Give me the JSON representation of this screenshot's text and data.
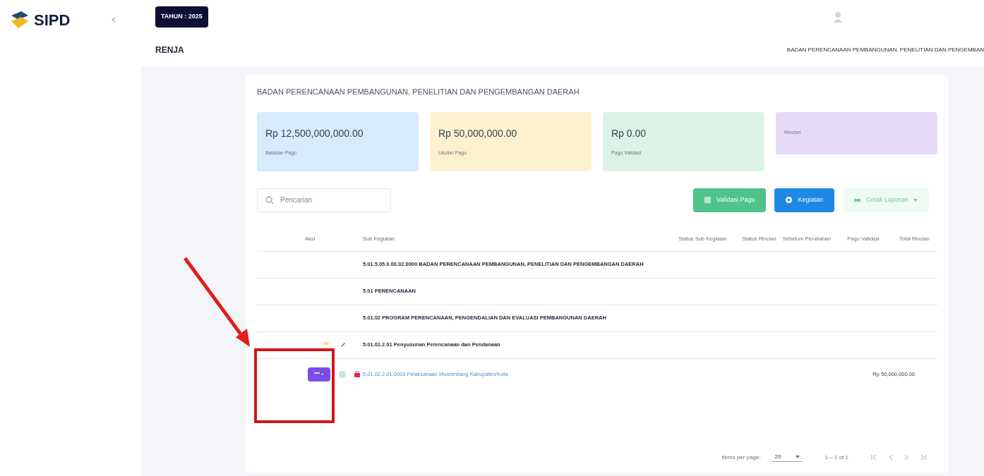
{
  "header": {
    "logo": "SIPD",
    "year_badge": "TAHUN : 2025",
    "module": "RENJA",
    "agency": "BADAN PERENCANAAN PEMBANGUNAN, PENELITIAN DAN PENGEMBAN"
  },
  "card": {
    "title": "BADAN PERENCANAAN PEMBANGUNAN, PENELITIAN DAN PENGEMBANGAN DAERAH",
    "summaries": [
      {
        "value": "Rp 12,500,000,000.00",
        "label": "Batasan Pagu",
        "color": "#d6ebfb"
      },
      {
        "value": "Rp 50,000,000.00",
        "label": "Usulan Pagu",
        "color": "#fdf1cf"
      },
      {
        "value": "Rp 0.00",
        "label": "Pagu Validasi",
        "color": "#dcf2e6"
      },
      {
        "label": "Rincian",
        "color": "#e6dcf7"
      }
    ],
    "search": {
      "placeholder": "Pencarian"
    },
    "buttons": [
      {
        "kind": "validate",
        "label": "Validasi Pagu"
      },
      {
        "kind": "add",
        "label": "Kegiatan"
      },
      {
        "kind": "print",
        "label": "Cetak Laporan"
      }
    ],
    "columns": [
      "Aksi",
      "Sub Kegiatan",
      "Status Sub Kegiatan",
      "Status Rincian",
      "Sebelum Perubahan",
      "Pagu Validasi",
      "Total Rincian"
    ],
    "rows": [
      {
        "kind": "group",
        "text": "5.01.5.05.0.00.02.0000 BADAN PERENCANAAN PEMBANGUNAN, PENELITIAN DAN PENGEMBANGAN DAERAH"
      },
      {
        "kind": "group",
        "text": "5.01 PERENCANAAN"
      },
      {
        "kind": "group",
        "text": "5.01.02 PROGRAM PERENCANAAN, PENGENDALIAN DAN EVALUASI PEMBANGUNAN DAERAH"
      },
      {
        "kind": "activity",
        "text": "5.01.02.2.01 Penyusunan Perencanaan dan Pendanaan"
      },
      {
        "kind": "sub",
        "text": "5.01.02.2.01.0003 Pelaksanaan Musrenbang Kabupaten/Kota",
        "pagu": "Rp 50,000,000.00"
      }
    ],
    "pagination": {
      "per_page_label": "Items per page:",
      "per_page": "20",
      "range": "1 – 1 of 1"
    }
  }
}
